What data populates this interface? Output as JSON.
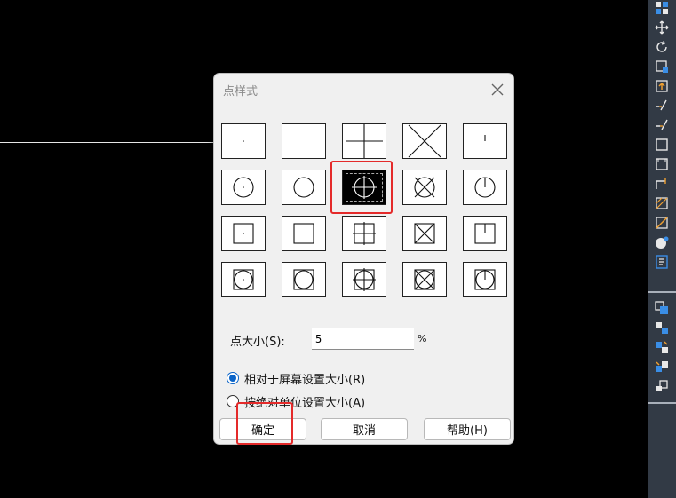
{
  "dialog": {
    "title": "点样式",
    "styles": [
      {
        "id": "dot"
      },
      {
        "id": "none"
      },
      {
        "id": "plus"
      },
      {
        "id": "x"
      },
      {
        "id": "tick"
      },
      {
        "id": "circle-dot"
      },
      {
        "id": "circle"
      },
      {
        "id": "circle-plus",
        "selected": true
      },
      {
        "id": "circle-x"
      },
      {
        "id": "circle-tick"
      },
      {
        "id": "square-dot"
      },
      {
        "id": "square"
      },
      {
        "id": "square-plus"
      },
      {
        "id": "square-x"
      },
      {
        "id": "square-tick"
      },
      {
        "id": "square-circle-dot"
      },
      {
        "id": "square-circle"
      },
      {
        "id": "square-circle-plus"
      },
      {
        "id": "square-circle-x"
      },
      {
        "id": "square-circle-tick"
      }
    ],
    "point_size_label": "点大小(S):",
    "point_size_value": "5",
    "point_size_unit": "%",
    "radio_relative": "相对于屏幕设置大小(R)",
    "radio_absolute": "按绝对单位设置大小(A)",
    "ok_label": "确定",
    "cancel_label": "取消",
    "help_label": "帮助(H)"
  },
  "toolbar": {
    "icons": [
      "layers-icon",
      "move-icon",
      "rotate-icon",
      "scale-icon",
      "upload-icon",
      "extend-icon",
      "trim-icon",
      "rect-icon",
      "dash-rect-icon",
      "corner-icon",
      "hatch-icon",
      "hatch2-icon",
      "sphere-icon",
      "properties-icon",
      "copy-icon",
      "array-icon",
      "swap-icon",
      "mirror-icon",
      "explode-icon"
    ]
  },
  "colors": {
    "accent": "#0a64c8",
    "highlight": "#e42a2a",
    "toolbar_bg": "#323a45"
  }
}
